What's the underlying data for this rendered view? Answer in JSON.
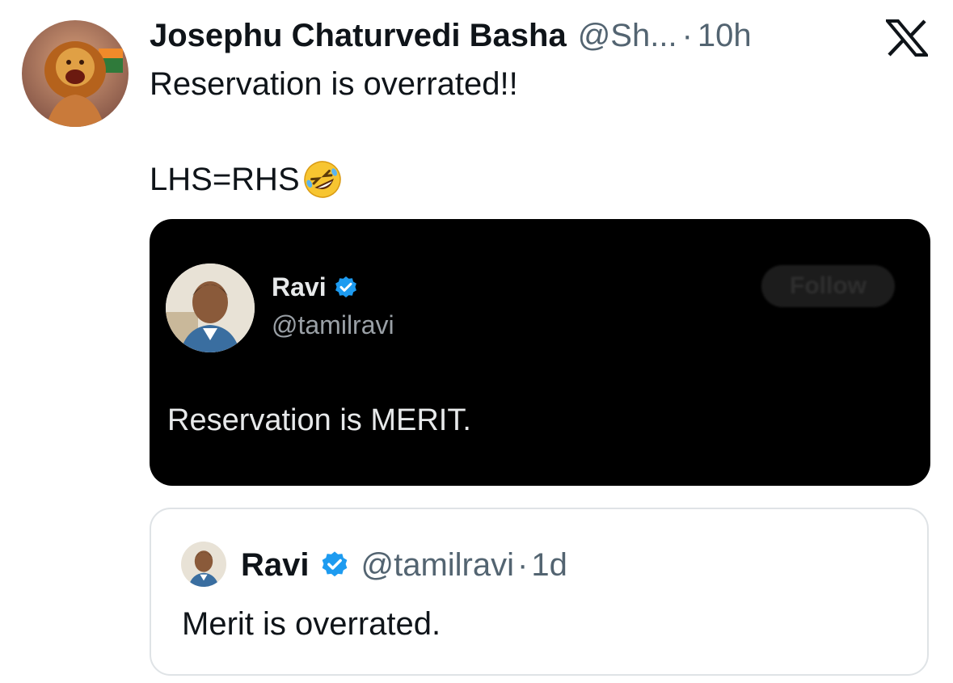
{
  "post": {
    "author_name": "Josephu Chaturvedi Basha",
    "author_handle": "@Sh...",
    "separator": "·",
    "time": "10h",
    "text_line1": "Reservation is overrated!!",
    "text_line2": "LHS=RHS",
    "emoji": "rolling-on-floor-laughing-emoji"
  },
  "media": {
    "name": "Ravi",
    "handle": "@tamilravi",
    "follow_label": "Follow",
    "text": "Reservation is MERIT.",
    "verified": true
  },
  "quote": {
    "name": "Ravi",
    "handle": "@tamilravi",
    "separator": "·",
    "time": "1d",
    "text": "Merit is overrated.",
    "verified": true
  },
  "colors": {
    "text_primary": "#0f1419",
    "text_secondary": "#536471",
    "verified_blue": "#1d9bf0",
    "media_bg": "#000000"
  },
  "icons": {
    "brand": "x-logo-icon",
    "verified": "verified-badge-icon"
  }
}
